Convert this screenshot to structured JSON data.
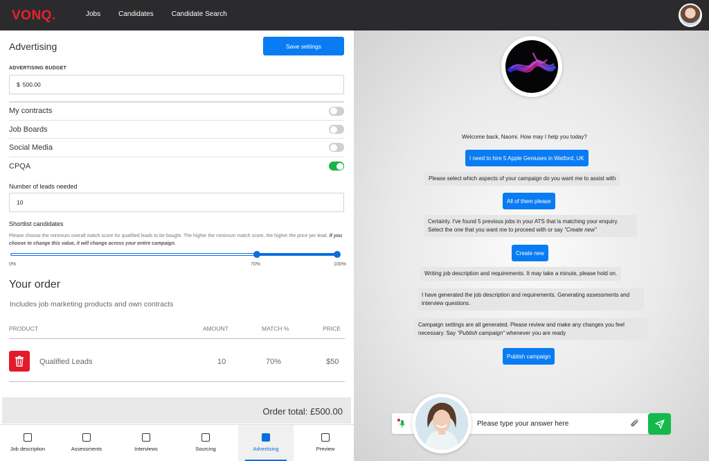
{
  "header": {
    "logo": "VONQ.",
    "nav": [
      "Jobs",
      "Candidates",
      "Candidate Search"
    ]
  },
  "advertising": {
    "title": "Advertising",
    "save_label": "Save settings",
    "budget_label": "ADVERTISING BUDGET",
    "budget_currency": "$",
    "budget_value": "500.00",
    "toggles": [
      {
        "label": "My contracts",
        "on": false
      },
      {
        "label": "Job Boards",
        "on": false
      },
      {
        "label": "Social Media",
        "on": false
      },
      {
        "label": "CPQA",
        "on": true
      }
    ],
    "leads_label": "Number of leads needed",
    "leads_value": "10",
    "shortlist_label": "Shortlist candidates",
    "shortlist_help": "Please choose the minimum overall match score for qualified leads to be bought. The higher the minimum match score, the higher the price per lead.",
    "shortlist_help_emph": "If you choose to change this value, it will change across your entire campaign.",
    "slider": {
      "min_label": "0%",
      "value_label": "70%",
      "max_label": "100%",
      "value": 70,
      "max": 100
    }
  },
  "order": {
    "title": "Your order",
    "subtitle": "Includes job marketing products and own contracts",
    "columns": [
      "PRODUCT",
      "AMOUNT",
      "MATCH %",
      "PRICE"
    ],
    "rows": [
      {
        "product": "Qualified Leads",
        "amount": "10",
        "match": "70%",
        "price": "$50"
      }
    ],
    "total": "Order total: £500.00"
  },
  "tabs": [
    {
      "label": "Job description",
      "icon": "download-icon",
      "active": false
    },
    {
      "label": "Assessments",
      "icon": "bar-chart-icon",
      "active": false
    },
    {
      "label": "Interviews",
      "icon": "person-icon",
      "active": false
    },
    {
      "label": "Sourcing",
      "icon": "person-search-icon",
      "active": false
    },
    {
      "label": "Advertising",
      "icon": "megaphone-icon",
      "active": true
    },
    {
      "label": "Preview",
      "icon": "play-icon",
      "active": false
    }
  ],
  "chat": {
    "messages": [
      {
        "who": "bot",
        "text": "Welcome back, Naomi. How may I help you today?"
      },
      {
        "who": "user",
        "text": "I need to hire 5 Apple Geniuses in Watford, UK"
      },
      {
        "who": "bot",
        "text": "Please select which aspects of your campaign do you want me to assist with"
      },
      {
        "who": "user",
        "text": "All of them please"
      },
      {
        "who": "bot",
        "text": "Certainly. I've found 5 previous jobs in your ATS that is matching your enquiry. Select the one that you want me to proceed with or say",
        "emph": "\"Create new\""
      },
      {
        "who": "user",
        "text": "Create new"
      },
      {
        "who": "bot",
        "text": "Writing job description and requirements. It may take a minute, please hold on."
      },
      {
        "who": "bot",
        "text": "I have generated the job description and requirements. Generating assessments and interview questions."
      },
      {
        "who": "bot",
        "text": "Campaign settings are all generated. Please review and make any changes you feel necessary. Say",
        "emph": "\"Publish campaign\"",
        "tail": "whenever you are ready"
      },
      {
        "who": "user",
        "text": "Publish campaign"
      }
    ],
    "input_placeholder": "Please type your answer here"
  }
}
